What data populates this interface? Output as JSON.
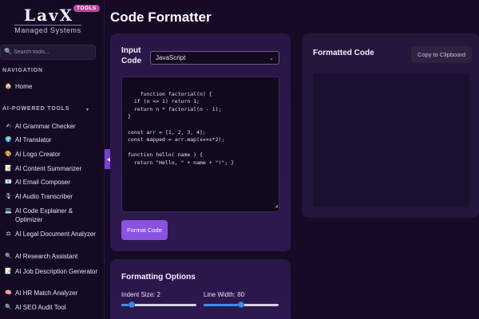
{
  "brand": {
    "name": "LavX",
    "tag": "TOOLS",
    "subtitle": "Managed Systems"
  },
  "search": {
    "placeholder": "Search tools..."
  },
  "nav": {
    "navigation_heading": "NAVIGATION",
    "home": {
      "icon": "🏠",
      "label": "Home"
    },
    "ai_tools_heading": "AI-POWERED TOOLS",
    "ai_tools_chevron": "▾",
    "items": [
      {
        "icon": "✍",
        "label": "AI Grammar Checker"
      },
      {
        "icon": "🌍",
        "label": "AI Translator"
      },
      {
        "icon": "🎨",
        "label": "AI Logo Creator"
      },
      {
        "icon": "📝",
        "label": "AI Content Summarizer"
      },
      {
        "icon": "📧",
        "label": "AI Email Composer"
      },
      {
        "icon": "🎙",
        "label": "AI Audio Transcriber"
      },
      {
        "icon": "💻",
        "label": "AI Code Explainer & Optimizer"
      },
      {
        "icon": "⚖",
        "label": "AI Legal Document Analyzer"
      },
      {
        "icon": "🔍",
        "label": "AI Research Assistant"
      },
      {
        "icon": "📝",
        "label": "AI Job Description Generator"
      },
      {
        "icon": "🧠",
        "label": "AI HR Match Analyzer"
      },
      {
        "icon": "🔍",
        "label": "AI SEO Audit Tool"
      }
    ]
  },
  "collapse_toggle": "◀",
  "page": {
    "title": "Code Formatter"
  },
  "input_panel": {
    "label": "Input Code",
    "language": "JavaScript",
    "caret": "⌄",
    "code": "function factorial(n) {\n  if (n <= 1) return 1;\n  return n * factorial(n - 1);\n}\n\nconst arr = [1, 2, 3, 4];\nconst mapped = arr.map(x=>x*2);\n\nfunction hello( name ) {\n  return \"Hello, \" + name + \"!\"; }",
    "format_button": "Format Code"
  },
  "output_panel": {
    "title": "Formatted Code",
    "copy_button": "Copy to Clipboard"
  },
  "options": {
    "title": "Formatting Options",
    "indent_label": "Indent Size: 2",
    "indent_value": 2,
    "indent_min": 1,
    "indent_max": 8,
    "line_width_label": "Line Width: 80",
    "line_width_value": 80,
    "line_width_min": 40,
    "line_width_max": 120
  },
  "colors": {
    "accent": "#8a52e0",
    "slider": "#3f8cf0",
    "brand_tag": "#b4489a"
  }
}
